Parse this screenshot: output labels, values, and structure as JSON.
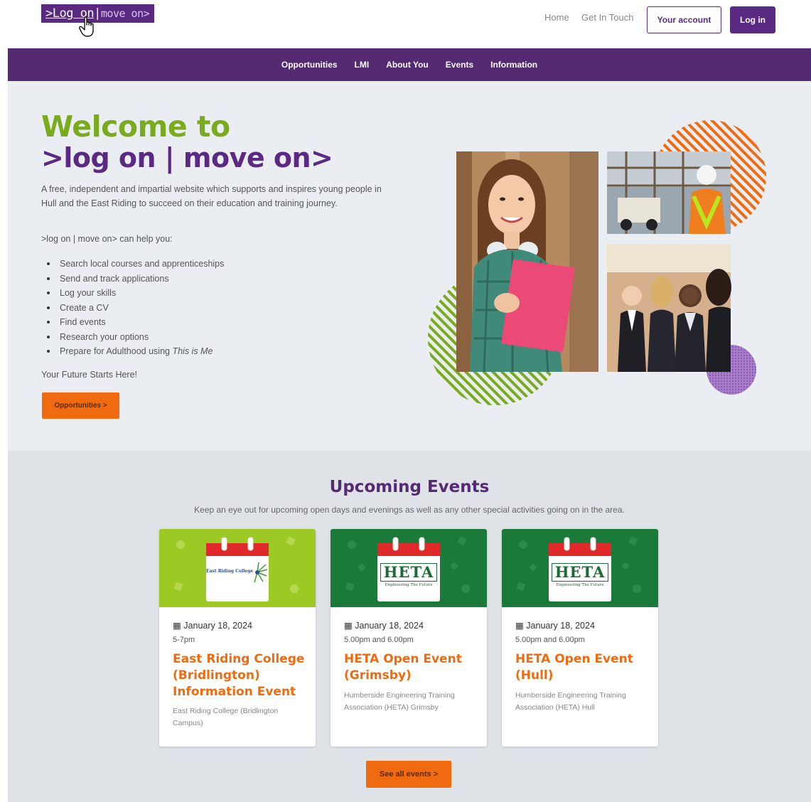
{
  "header": {
    "logo_part1": ">Log on",
    "logo_sep": "|",
    "logo_part2": "move on>",
    "home": "Home",
    "contact": "Get In Touch",
    "account": "Your account",
    "login": "Log in"
  },
  "nav": {
    "items": [
      "Opportunities",
      "LMI",
      "About You",
      "Events",
      "Information"
    ]
  },
  "hero": {
    "title_line1": "Welcome to",
    "title_line2": ">log on | move on>",
    "intro": "A free, independent and impartial website which supports and inspires young people in Hull and the East Riding to succeed on their education and training journey.",
    "help": ">log on | move on> can help you:",
    "list": [
      "Search local courses and apprenticeships",
      "Send and track applications",
      "Log your skills",
      "Create a CV",
      "Find events",
      "Research your options",
      "Prepare for Adulthood using"
    ],
    "list_em": "This is Me",
    "future": "Your Future Starts Here!",
    "button": "Opportunities >"
  },
  "events": {
    "title": "Upcoming Events",
    "subtitle": "Keep an eye out for upcoming open days and evenings as well as any other special activities going on in the area.",
    "cards": [
      {
        "logo": "East Riding College",
        "date": "January 18, 2024",
        "time": "5-7pm",
        "title": "East Riding College (Bridlington) Information Event",
        "location": "East Riding College (Bridlington Campus)"
      },
      {
        "logo": "HETA",
        "logo_sub": "Engineering The Future",
        "date": "January 18, 2024",
        "time": "5.00pm and 6.00pm",
        "title": "HETA Open Event (Grimsby)",
        "location": "Humberside Engineering Training Association (HETA) Grimsby"
      },
      {
        "logo": "HETA",
        "logo_sub": "Engineering The Future",
        "date": "January 18, 2024",
        "time": "5.00pm and 6.00pm",
        "title": "HETA Open Event (Hull)",
        "location": "Humberside Engineering Training Association (HETA) Hull"
      }
    ],
    "see_all": "See all events >"
  },
  "colors": {
    "purple": "#542b72",
    "green": "#7aab1e",
    "orange": "#f06a0f"
  }
}
